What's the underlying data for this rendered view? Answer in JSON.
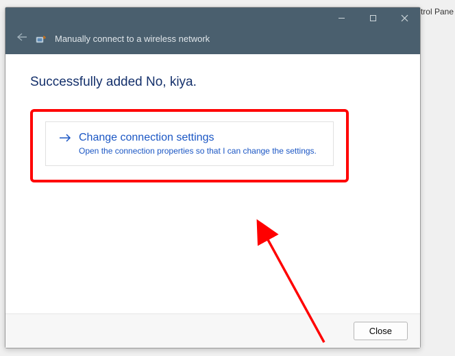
{
  "background": {
    "hint_text": "ntrol Pane"
  },
  "titlebar": {
    "title": "Manually connect to a wireless network"
  },
  "content": {
    "success_heading": "Successfully added No, kiya.",
    "option": {
      "title": "Change connection settings",
      "description": "Open the connection properties so that I can change the settings."
    }
  },
  "footer": {
    "close_label": "Close"
  }
}
